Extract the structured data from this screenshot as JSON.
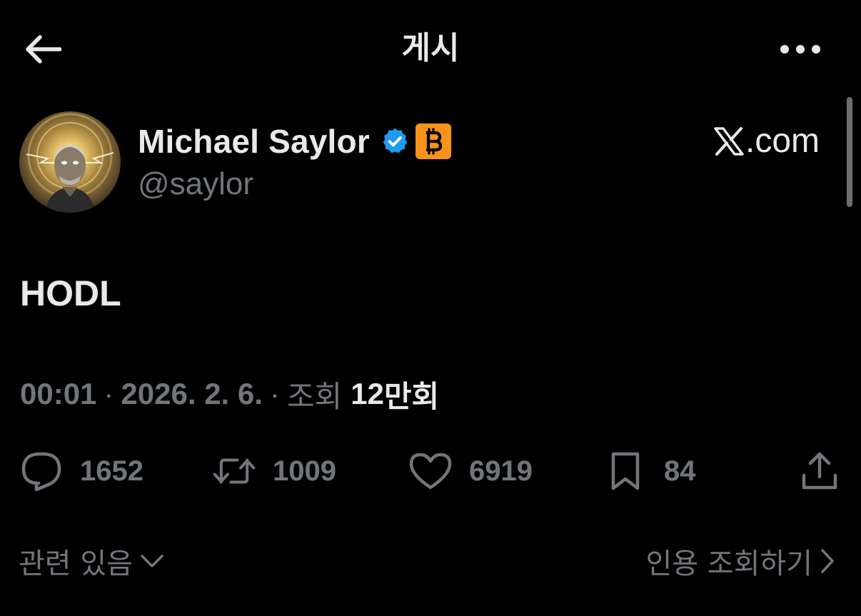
{
  "header": {
    "title": "게시",
    "back_icon": "arrow-left-icon",
    "more_icon": "more-horizontal-icon"
  },
  "post": {
    "author": {
      "name": "Michael Saylor",
      "handle": "@saylor",
      "verified_icon": "verified-badge-icon",
      "affiliate_badge_icon": "bitcoin-icon"
    },
    "source": {
      "logo_icon": "x-logo-icon",
      "label": ".com"
    },
    "text": "HODL",
    "meta": {
      "time": "00:01",
      "separator": "·",
      "date": "2026. 2. 6.",
      "views_prefix": "조회",
      "views_number": "12",
      "views_unit": "만회"
    },
    "actions": {
      "replies": "1652",
      "reposts": "1009",
      "likes": "6919",
      "bookmarks": "84"
    }
  },
  "footer": {
    "related_label": "관련 있음",
    "quotes_label": "인용 조회하기"
  },
  "colors": {
    "background": "#000000",
    "primary_text": "#e7e9ea",
    "secondary_text": "#71767b",
    "verified_blue": "#1d9bf0",
    "bitcoin_orange": "#f7931a"
  }
}
